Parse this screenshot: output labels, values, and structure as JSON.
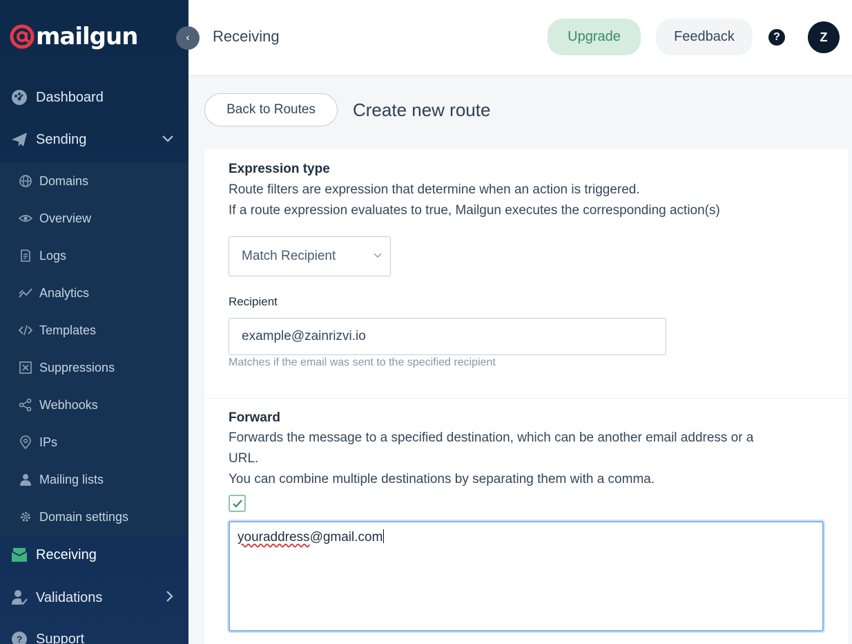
{
  "sidebar": {
    "logo_text": "mailgun",
    "main_items": [
      {
        "label": "Dashboard",
        "icon": "dashboard-icon"
      },
      {
        "label": "Sending",
        "icon": "paper-plane-icon"
      },
      {
        "label": "Receiving",
        "icon": "inbox-icon"
      },
      {
        "label": "Validations",
        "icon": "user-check-icon"
      },
      {
        "label": "Support",
        "icon": "help-circle-icon"
      }
    ],
    "sub_items": [
      {
        "label": "Domains",
        "icon": "globe-icon"
      },
      {
        "label": "Overview",
        "icon": "eye-icon"
      },
      {
        "label": "Logs",
        "icon": "document-icon"
      },
      {
        "label": "Analytics",
        "icon": "chart-line-icon"
      },
      {
        "label": "Templates",
        "icon": "code-icon"
      },
      {
        "label": "Suppressions",
        "icon": "block-icon"
      },
      {
        "label": "Webhooks",
        "icon": "share-icon"
      },
      {
        "label": "IPs",
        "icon": "location-pin-icon"
      },
      {
        "label": "Mailing lists",
        "icon": "person-icon"
      },
      {
        "label": "Domain settings",
        "icon": "gear-icon"
      }
    ],
    "collapse_glyph": "‹",
    "sending_chevron": "⌄",
    "validations_chevron": "›"
  },
  "header": {
    "title": "Receiving",
    "upgrade_label": "Upgrade",
    "feedback_label": "Feedback",
    "help_glyph": "?",
    "avatar_initial": "Z"
  },
  "page": {
    "back_label": "Back to Routes",
    "title": "Create new route"
  },
  "expression": {
    "heading": "Expression type",
    "desc_line1": "Route filters are expression that determine when an action is triggered.",
    "desc_line2": "If a route expression evaluates to true, Mailgun executes the corresponding action(s)",
    "select_value": "Match Recipient",
    "recipient_label": "Recipient",
    "recipient_value": "example@zainrizvi.io",
    "recipient_help": "Matches if the email was sent to the specified recipient"
  },
  "forward": {
    "heading": "Forward",
    "desc_line1": "Forwards the message to a specified destination, which can be another email address or a",
    "desc_line2": "URL.",
    "desc_line3": "You can combine multiple destinations by separating them with a comma.",
    "checked": true,
    "value_misspelled": "youraddress",
    "value_rest": "@gmail.com"
  },
  "colors": {
    "sidebar_bg": "#0e2a4a",
    "accent_red": "#e8374a",
    "upgrade_bg": "#d5ecdf",
    "receiving_icon": "#3fb37f"
  }
}
